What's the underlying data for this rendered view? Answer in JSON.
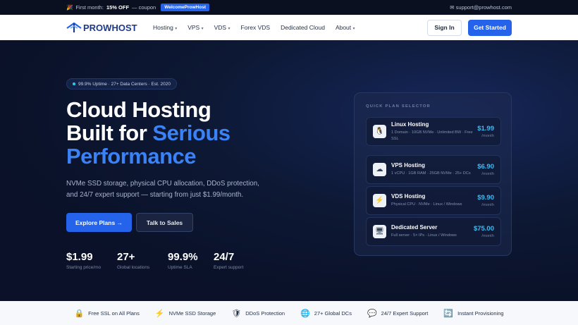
{
  "topbar": {
    "promo_icon": "🎉",
    "promo_prefix": "First month:",
    "promo_discount": "15% OFF",
    "promo_suffix": "— coupon",
    "coupon_code": "WelcomeProwHost",
    "email_icon": "✉",
    "email": "support@prowhost.com"
  },
  "nav": {
    "brand": "PROWHOST",
    "items": [
      {
        "label": "Hosting",
        "caret": "▾"
      },
      {
        "label": "VPS",
        "caret": "▾"
      },
      {
        "label": "VDS",
        "caret": "▾"
      },
      {
        "label": "Forex VDS",
        "caret": ""
      },
      {
        "label": "Dedicated Cloud",
        "caret": ""
      },
      {
        "label": "About",
        "caret": "▾"
      }
    ],
    "signin": "Sign In",
    "get_started": "Get Started"
  },
  "hero": {
    "badge": "99.9% Uptime · 27+ Data Centers · Est. 2020",
    "title_line1": "Cloud Hosting",
    "title_line2a": "Built for ",
    "title_line2b": "Serious",
    "title_line3": "Performance",
    "subtitle": "NVMe SSD storage, physical CPU allocation, DDoS protection, and 24/7 expert support — starting from just $1.99/month.",
    "explore": "Explore Plans →",
    "talk": "Talk to Sales",
    "stats": [
      {
        "value": "$1.99",
        "label": "Starting price/mo"
      },
      {
        "value": "27+",
        "label": "Global locations"
      },
      {
        "value": "99.9%",
        "label": "Uptime SLA"
      },
      {
        "value": "24/7",
        "label": "Expert support"
      }
    ]
  },
  "panel": {
    "title": "QUICK PLAN SELECTOR",
    "plans": [
      {
        "icon": "🐧",
        "icon_name": "linux-icon",
        "name": "Linux Hosting",
        "desc": "1 Domain · 10GB NVMe · Unlimited BW · Free SSL",
        "price": "$1.99",
        "per": "/month"
      },
      {
        "icon": "☁",
        "icon_name": "cloud-icon",
        "name": "VPS Hosting",
        "desc": "1 vCPU · 1GB RAM · 25GB NVMe · 25+ DCs",
        "price": "$6.90",
        "per": "/month"
      },
      {
        "icon": "⚡",
        "icon_name": "lightning-icon",
        "name": "VDS Hosting",
        "desc": "Physical CPU · NVMe · Linux / Windows",
        "price": "$9.90",
        "per": "/month"
      },
      {
        "icon": "🖥",
        "icon_name": "server-icon",
        "name": "Dedicated Server",
        "desc": "Full server · 5× IPs · Linux / Windows",
        "price": "$75.00",
        "per": "/month"
      }
    ]
  },
  "features": [
    {
      "icon": "🔒",
      "icon_name": "lock-icon",
      "label": "Free SSL on All Plans"
    },
    {
      "icon": "⚡",
      "icon_name": "lightning-icon",
      "label": "NVMe SSD Storage"
    },
    {
      "icon": "🛡",
      "icon_name": "shield-icon",
      "label": "DDoS Protection"
    },
    {
      "icon": "🌐",
      "icon_name": "globe-icon",
      "label": "27+ Global DCs"
    },
    {
      "icon": "💬",
      "icon_name": "chat-icon",
      "label": "24/7 Expert Support"
    },
    {
      "icon": "🔄",
      "icon_name": "refresh-icon",
      "label": "Instant Provisioning"
    }
  ],
  "colors": {
    "accent": "#2563eb",
    "price": "#38bdf8",
    "hero_bg": "#0b1226"
  }
}
